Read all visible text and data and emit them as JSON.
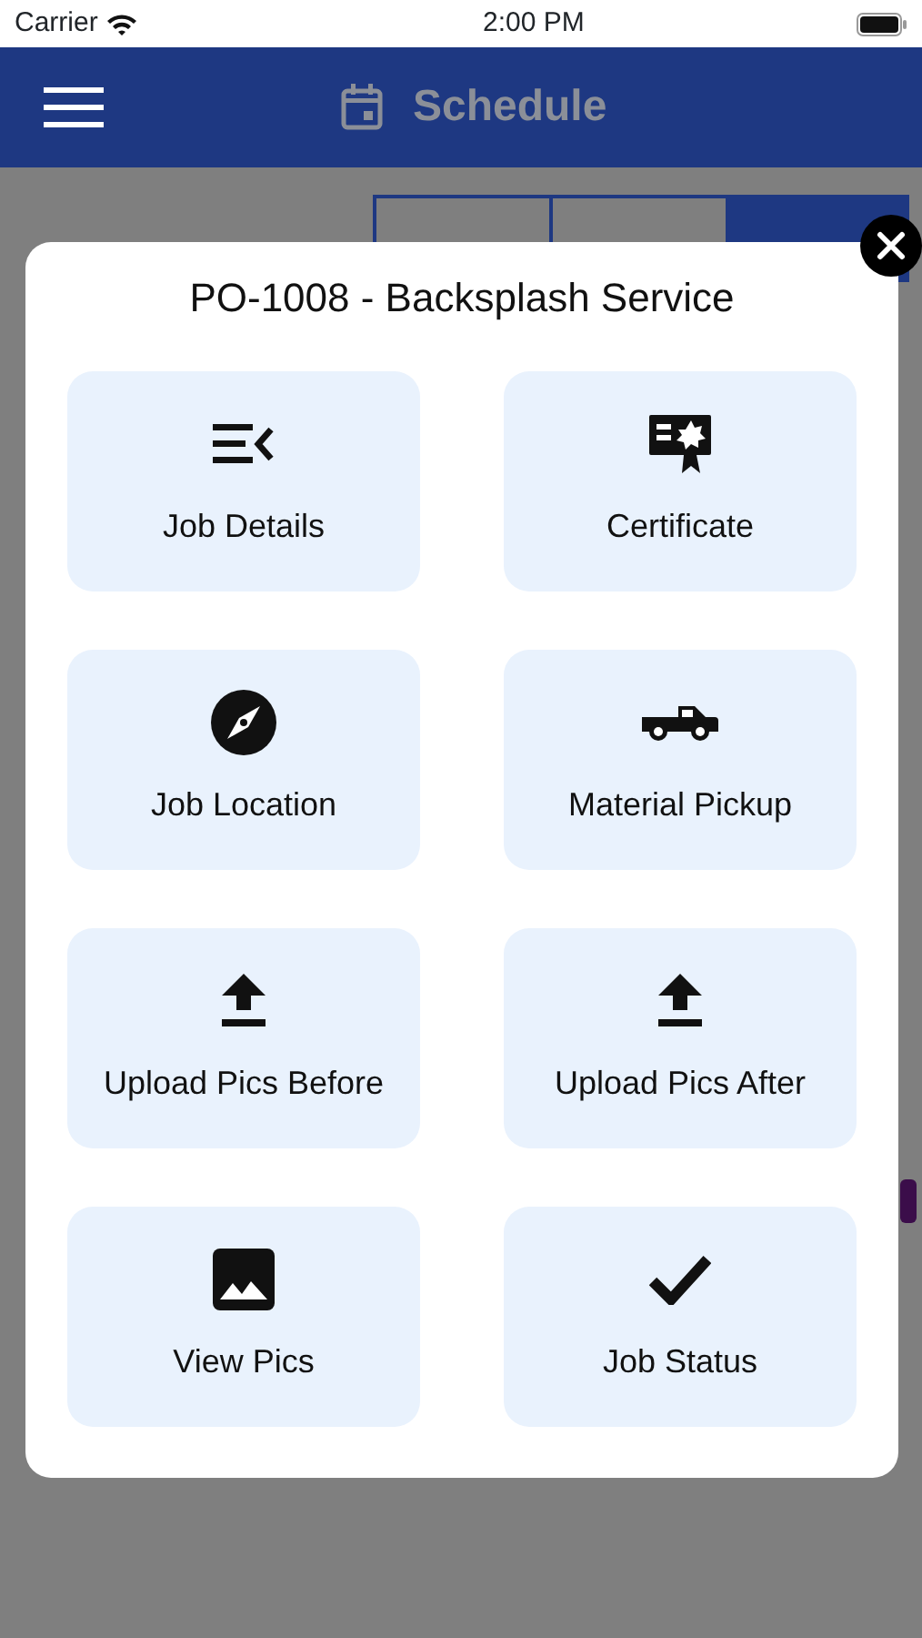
{
  "status_bar": {
    "carrier": "Carrier",
    "time": "2:00 PM"
  },
  "header": {
    "title": "Schedule"
  },
  "calendar": {
    "views": [
      {
        "selected": false
      },
      {
        "selected": false
      },
      {
        "selected": true
      }
    ]
  },
  "dialog": {
    "title": "PO-1008 - Backsplash Service",
    "actions": [
      {
        "label": "Job Details",
        "kind": "details"
      },
      {
        "label": "Certificate",
        "kind": "certificate"
      },
      {
        "label": "Job Location",
        "kind": "location"
      },
      {
        "label": "Material Pickup",
        "kind": "pickup"
      },
      {
        "label": "Upload Pics Before",
        "kind": "upload"
      },
      {
        "label": "Upload Pics After",
        "kind": "upload"
      },
      {
        "label": "View Pics",
        "kind": "gallery"
      },
      {
        "label": "Job Status",
        "kind": "status"
      }
    ]
  }
}
